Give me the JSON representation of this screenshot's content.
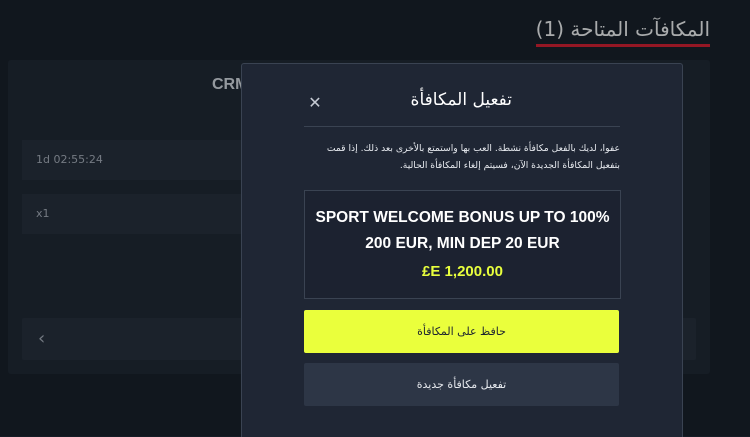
{
  "page": {
    "title": "المكافآت المتاحة (1)"
  },
  "background_card": {
    "title": "CRM",
    "rows": [
      "1d 02:55:24",
      "x1"
    ],
    "nav_prev_icon": "chevron-left-icon"
  },
  "modal": {
    "close_icon": "close-icon",
    "title": "تفعيل المكافأة",
    "description": "عفوا، لديك بالفعل مكافأة نشطة. العب بها واستمتع بالأخرى بعد ذلك. إذا قمت بتفعيل المكافأة الجديدة الآن، فسيتم إلغاء المكافأة الحالية.",
    "bonus": {
      "line1": "SPORT WELCOME BONUS UP TO 100%",
      "line2": "200 EUR, MIN DEP 20 EUR",
      "amount": "£E 1,200.00"
    },
    "buttons": {
      "keep": "حافظ على المكافأة",
      "activate": "تفعيل مكافأة جديدة"
    }
  },
  "colors": {
    "accent": "#eaff3c",
    "title_underline": "#e11d2e",
    "amount": "#e8ff3d"
  }
}
